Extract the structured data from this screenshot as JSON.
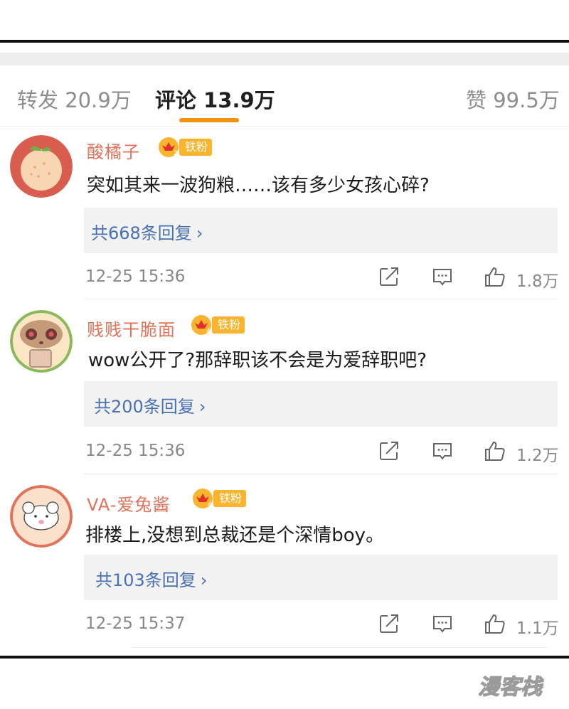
{
  "tabs": {
    "repost": "转发 20.9万",
    "comments": "评论 13.9万",
    "likes": "赞 99.5万"
  },
  "comments": [
    {
      "username": "酸橘子",
      "badge_level": "2",
      "badge_label": "铁粉",
      "content": "突如其来一波狗粮……该有多少女孩心碎?",
      "replies": "共668条回复",
      "time": "12-25 15:36",
      "likes": "1.8万"
    },
    {
      "username": "贱贱干脆面",
      "badge_level": "4",
      "badge_label": "铁粉",
      "content": "wow公开了?那辞职该不会是为爱辞职吧?",
      "replies": "共200条回复",
      "time": "12-25 15:36",
      "likes": "1.2万"
    },
    {
      "username": "VA-爱兔酱",
      "badge_level": "4",
      "badge_label": "铁粉",
      "content": "排楼上,没想到总裁还是个深情boy。",
      "replies": "共103条回复",
      "time": "12-25 15:37",
      "likes": "1.1万"
    }
  ],
  "reply_chevron": "›",
  "watermark": "漫客栈",
  "colors": {
    "accent": "#f29111",
    "username": "#e0735a",
    "link": "#4872b3",
    "badge": "#fbb42d"
  },
  "icons": [
    "share-icon",
    "comment-icon",
    "like-icon",
    "crown-icon"
  ]
}
